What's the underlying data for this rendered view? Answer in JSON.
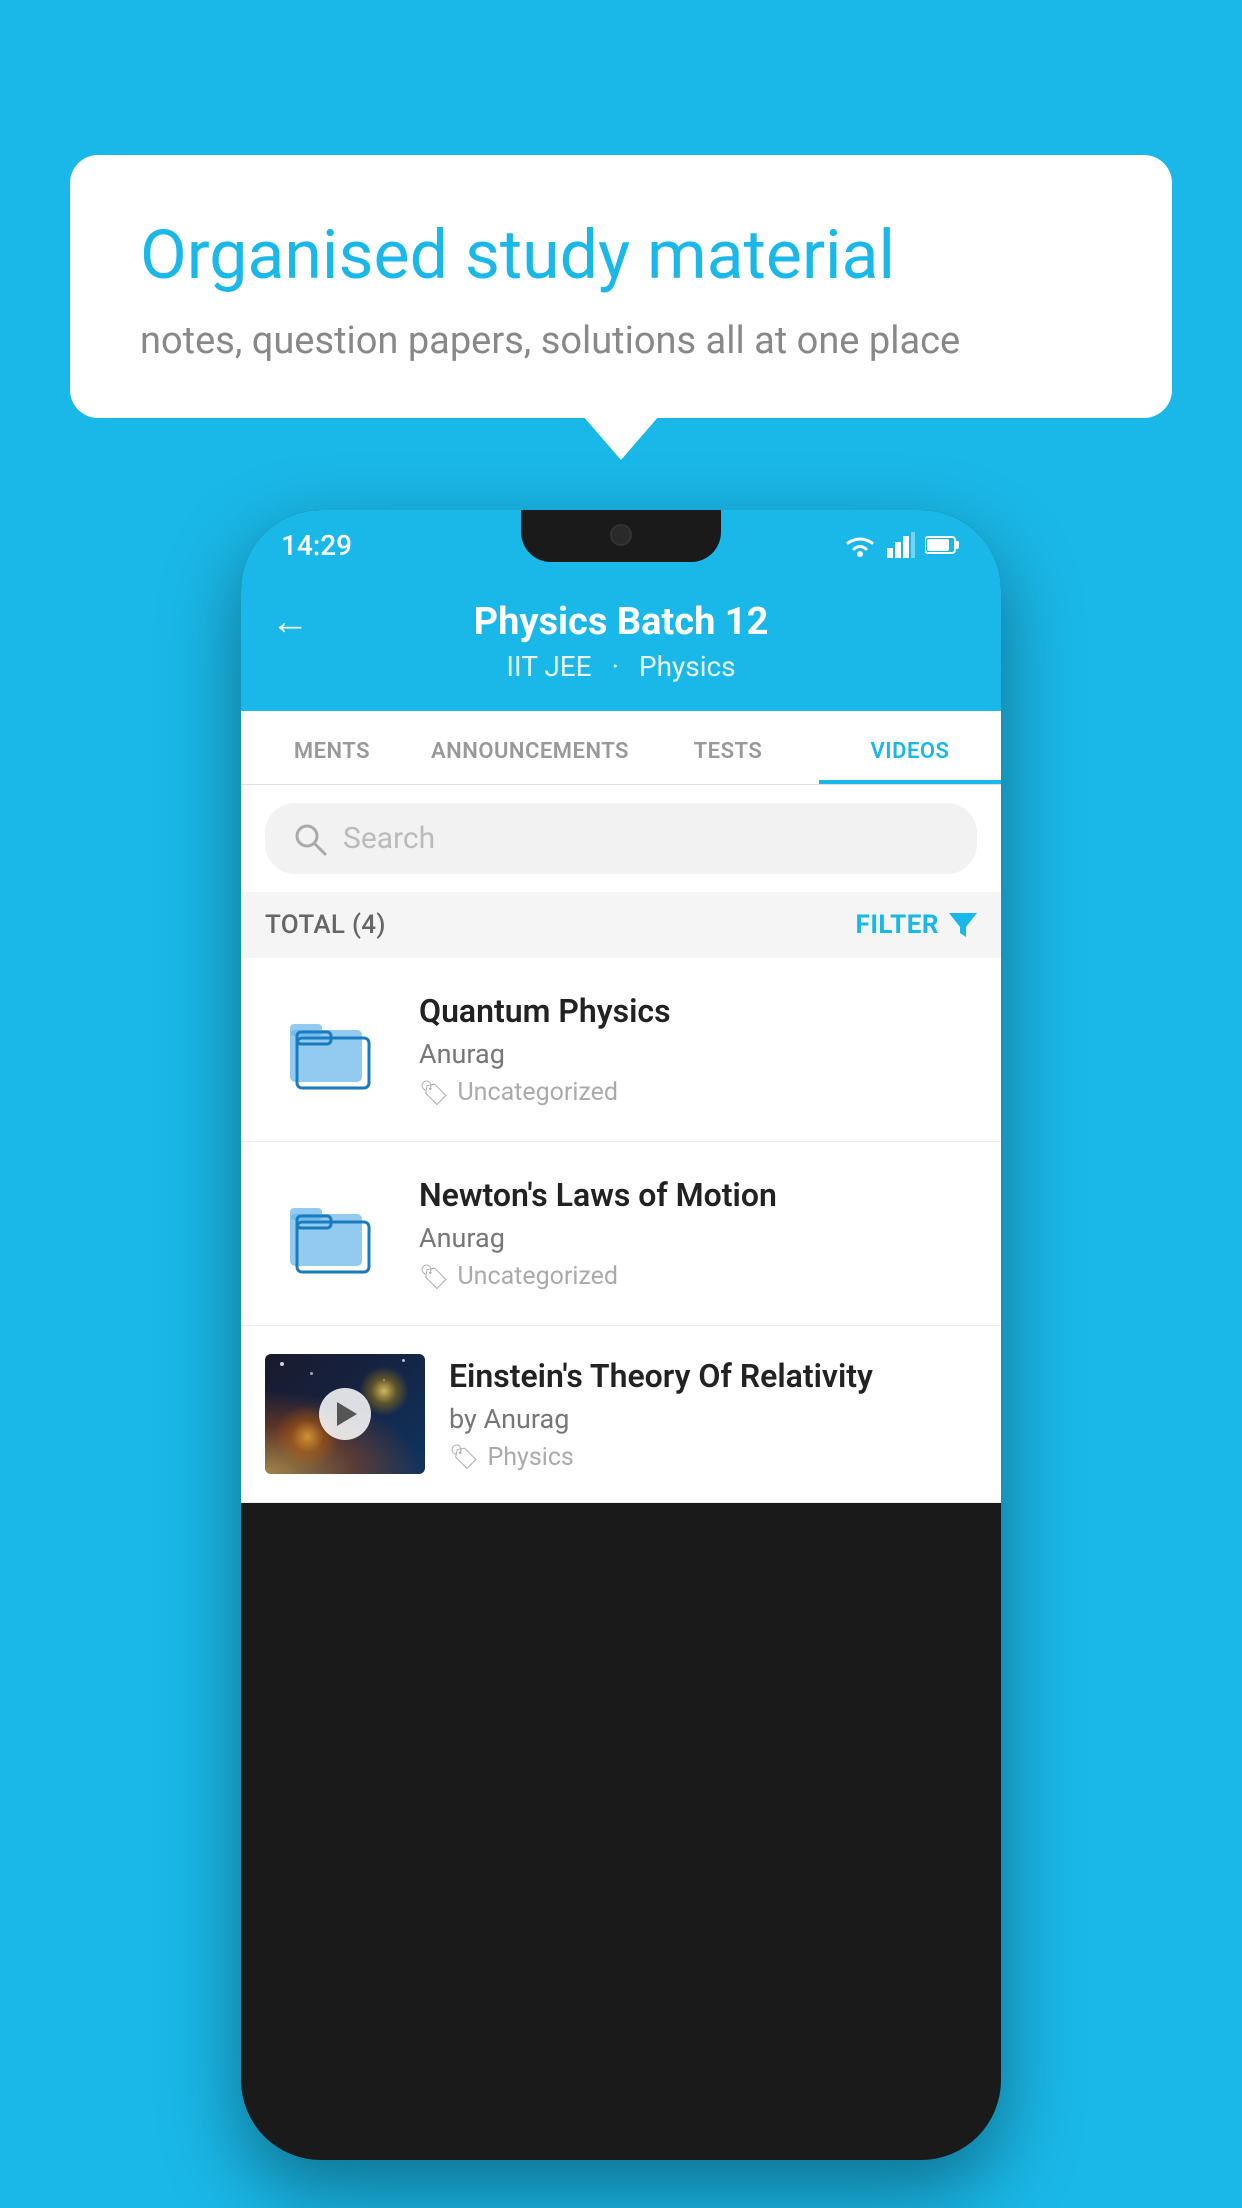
{
  "background": {
    "color": "#1ab8e8"
  },
  "speech_bubble": {
    "title": "Organised study material",
    "subtitle": "notes, question papers, solutions all at one place"
  },
  "phone": {
    "status_bar": {
      "time": "14:29"
    },
    "header": {
      "back_label": "←",
      "title": "Physics Batch 12",
      "tags": [
        "IIT JEE",
        "Physics"
      ]
    },
    "tabs": [
      {
        "label": "MENTS",
        "active": false
      },
      {
        "label": "ANNOUNCEMENTS",
        "active": false
      },
      {
        "label": "TESTS",
        "active": false
      },
      {
        "label": "VIDEOS",
        "active": true
      }
    ],
    "search": {
      "placeholder": "Search"
    },
    "filter_row": {
      "total_label": "TOTAL (4)",
      "filter_label": "FILTER"
    },
    "videos": [
      {
        "id": 1,
        "title": "Quantum Physics",
        "author": "Anurag",
        "tag": "Uncategorized",
        "type": "folder"
      },
      {
        "id": 2,
        "title": "Newton's Laws of Motion",
        "author": "Anurag",
        "tag": "Uncategorized",
        "type": "folder"
      },
      {
        "id": 3,
        "title": "Einstein's Theory Of Relativity",
        "author": "by Anurag",
        "tag": "Physics",
        "type": "video"
      }
    ]
  }
}
